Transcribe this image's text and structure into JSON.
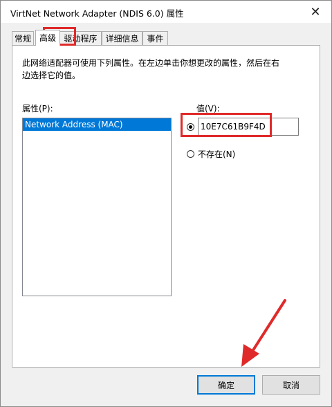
{
  "window": {
    "title": "VirtNet Network Adapter (NDIS 6.0) 属性",
    "close_glyph": "✕"
  },
  "tabs": [
    {
      "label": "常规"
    },
    {
      "label": "高级"
    },
    {
      "label": "驱动程序"
    },
    {
      "label": "详细信息"
    },
    {
      "label": "事件"
    }
  ],
  "active_tab": "高级",
  "panel": {
    "description": "此网络适配器可使用下列属性。在左边单击你想更改的属性，然后在右边选择它的值。",
    "property_label": "属性(P):",
    "properties": [
      {
        "label": "Network Address (MAC)",
        "selected": true
      }
    ],
    "value_label": "值(V):",
    "value_input": "10E7C61B9F4D",
    "absent_label": "不存在(N)"
  },
  "buttons": {
    "ok": "确定",
    "cancel": "取消"
  },
  "colors": {
    "highlight": "#e02a2a",
    "selection": "#0078d7"
  }
}
